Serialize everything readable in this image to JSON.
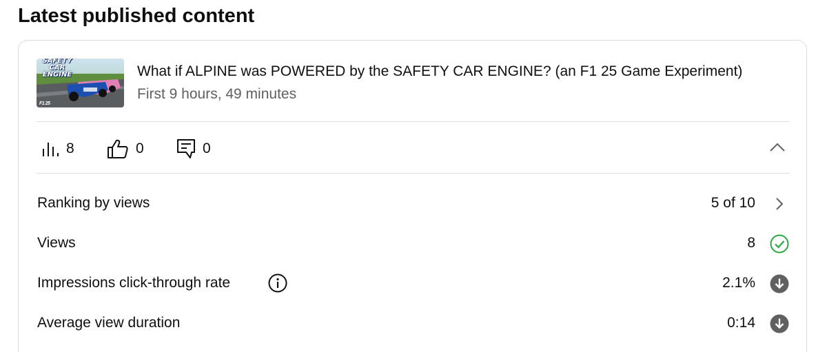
{
  "heading": "Latest published content",
  "video": {
    "thumbnail_text_line1": "SAFETY CAR",
    "thumbnail_text_line2": "ENGINE",
    "thumbnail_logo": "F1 25",
    "title": "What if ALPINE was POWERED by the SAFETY CAR ENGINE? (an F1 25 Game Experiment)",
    "period": "First 9 hours, 49 minutes"
  },
  "stats": {
    "views": "8",
    "likes": "0",
    "comments": "0",
    "views_icon": "bar-chart-icon",
    "likes_icon": "thumbs-up-icon",
    "comments_icon": "comment-icon",
    "collapse_icon": "chevron-up-icon"
  },
  "metrics": [
    {
      "label": "Ranking by views",
      "value": "5 of 10",
      "icon": "chevron-right-icon"
    },
    {
      "label": "Views",
      "value": "8",
      "icon": "check-circle-icon",
      "icon_color": "#2ba640"
    },
    {
      "label": "Impressions click-through rate",
      "value": "2.1%",
      "icon": "arrow-down-circle-icon",
      "icon_color": "#606060",
      "has_info": true
    },
    {
      "label": "Average view duration",
      "value": "0:14",
      "icon": "arrow-down-circle-icon",
      "icon_color": "#606060"
    }
  ]
}
